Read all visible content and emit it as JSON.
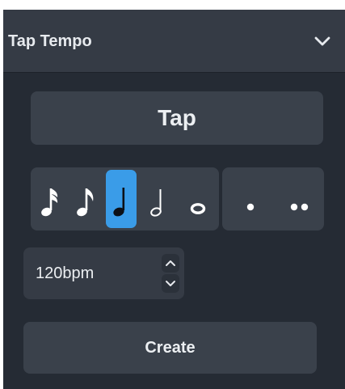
{
  "panel": {
    "title": "Tap Tempo",
    "collapse_icon": "chevron-down-icon"
  },
  "tap_button": {
    "label": "Tap"
  },
  "note_values": {
    "items": [
      {
        "name": "sixteenth-note",
        "icon": "sixteenth-note-icon",
        "selected": false
      },
      {
        "name": "eighth-note",
        "icon": "eighth-note-icon",
        "selected": false
      },
      {
        "name": "quarter-note",
        "icon": "quarter-note-icon",
        "selected": true
      },
      {
        "name": "half-note",
        "icon": "half-note-icon",
        "selected": false
      },
      {
        "name": "whole-note",
        "icon": "whole-note-icon",
        "selected": false
      }
    ],
    "dots": [
      {
        "name": "single-dot",
        "icon": "dot-icon"
      },
      {
        "name": "double-dot",
        "icon": "double-dot-icon"
      }
    ]
  },
  "tempo": {
    "value": "120bpm",
    "increment_icon": "chevron-up-icon",
    "decrement_icon": "chevron-down-icon"
  },
  "create_button": {
    "label": "Create"
  },
  "colors": {
    "panel_bg": "#252b34",
    "header_bg": "#353b45",
    "button_bg": "#3a414b",
    "accent": "#3a9ce8",
    "text": "#eceff2"
  }
}
